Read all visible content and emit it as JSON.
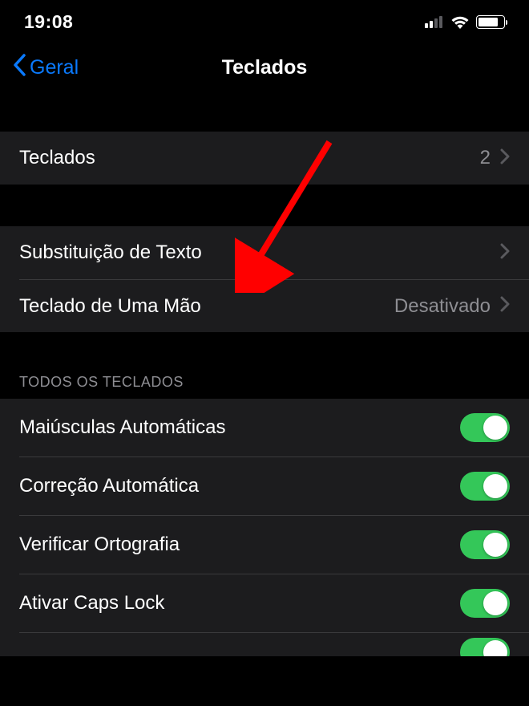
{
  "status": {
    "time": "19:08"
  },
  "nav": {
    "back_label": "Geral",
    "title": "Teclados"
  },
  "rows": {
    "keyboards_label": "Teclados",
    "keyboards_count": "2",
    "text_replacement_label": "Substituição de Texto",
    "one_handed_label": "Teclado de Uma Mão",
    "one_handed_value": "Desativado"
  },
  "section_header": "TODOS OS TECLADOS",
  "toggles": {
    "auto_caps_label": "Maiúsculas Automáticas",
    "auto_correct_label": "Correção Automática",
    "spell_check_label": "Verificar Ortografia",
    "caps_lock_label": "Ativar Caps Lock"
  },
  "colors": {
    "accent": "#0a7aff",
    "toggle_on": "#34c759",
    "arrow": "#ff0000"
  }
}
